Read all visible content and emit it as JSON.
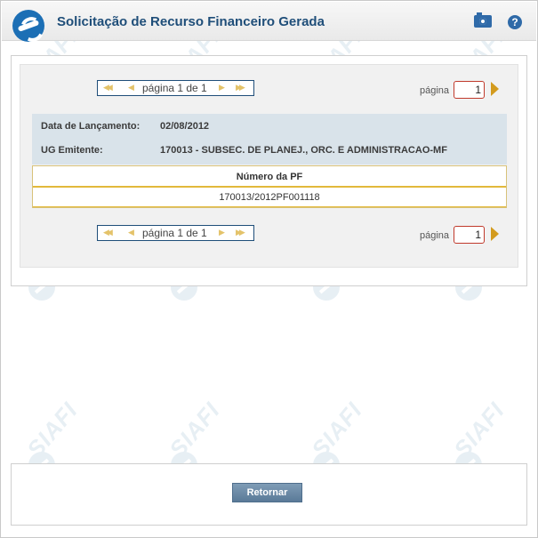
{
  "header": {
    "title": "Solicitação de Recurso Financeiro Gerada",
    "camera_icon": "camera-icon",
    "help_icon": "help-icon",
    "help_glyph": "?"
  },
  "watermark": {
    "text": "SIAFI"
  },
  "pager_top": {
    "first": "◀◀",
    "prev": "◀",
    "text": "página 1 de 1",
    "next": "▶",
    "last": "▶▶",
    "label": "página",
    "input_value": "1"
  },
  "pager_bottom": {
    "first": "◀◀",
    "prev": "◀",
    "text": "página 1 de 1",
    "next": "▶",
    "last": "▶▶",
    "label": "página",
    "input_value": "1"
  },
  "info": {
    "data_lancamento_label": "Data de Lançamento:",
    "data_lancamento_value": "02/08/2012",
    "ug_emitente_label": "UG Emitente:",
    "ug_emitente_value": "170013 - SUBSEC. DE PLANEJ., ORC. E ADMINISTRACAO-MF"
  },
  "table": {
    "header": "Número da PF",
    "rows": [
      "170013/2012PF001118"
    ]
  },
  "footer": {
    "return_label": "Retornar"
  },
  "colors": {
    "title": "#1f4e79",
    "accent_gold": "#e2b93b",
    "button": "#5a7a98",
    "info_bg": "#d9e3ea"
  }
}
